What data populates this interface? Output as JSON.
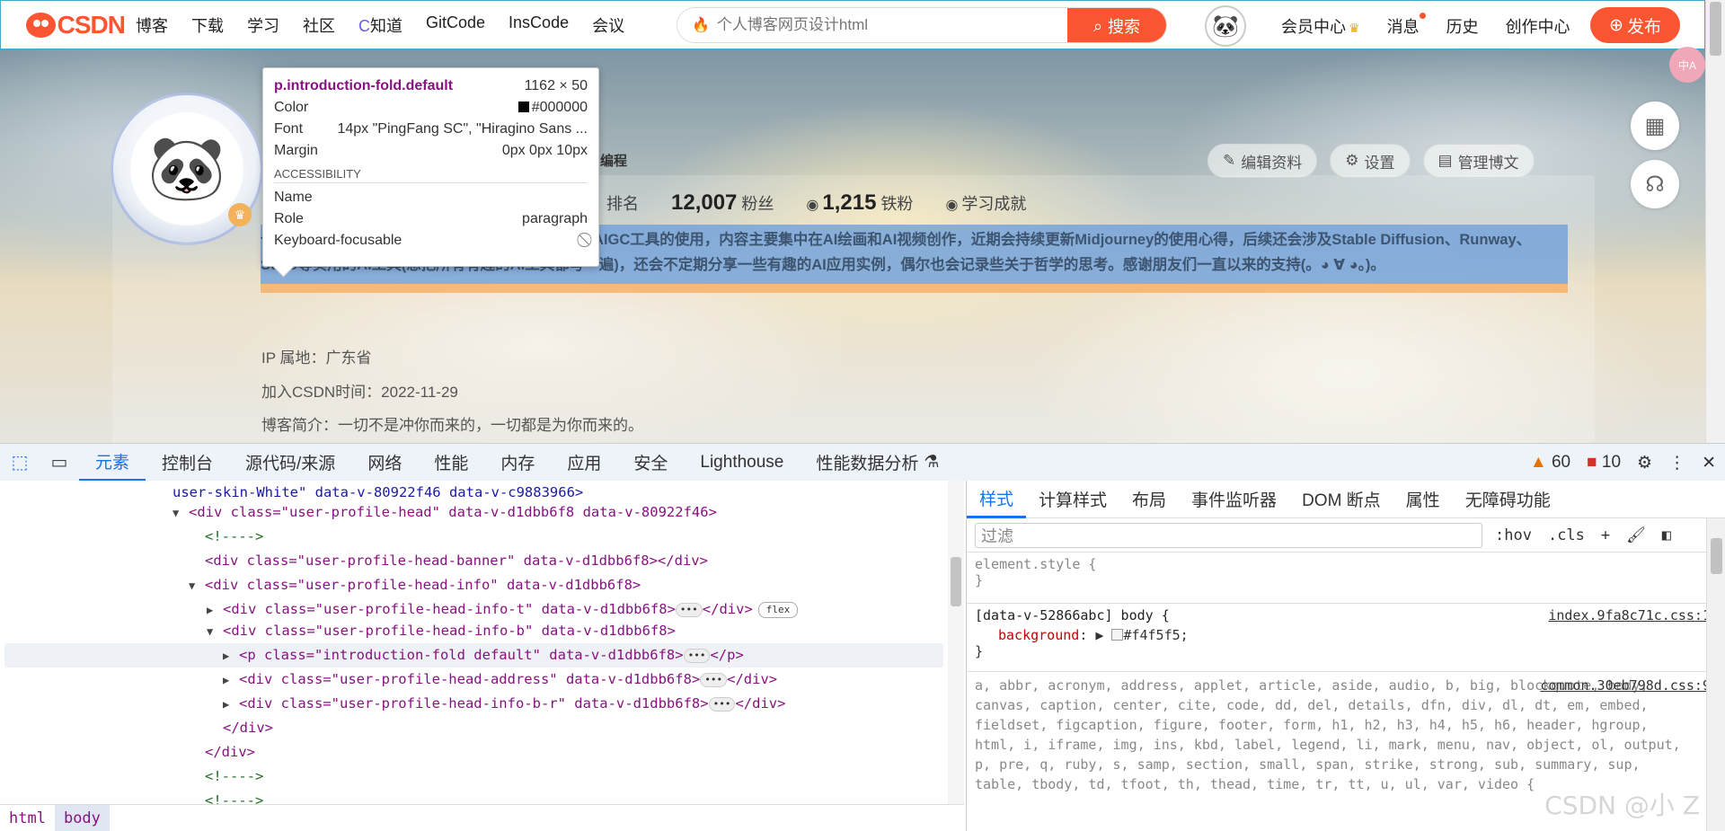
{
  "nav": {
    "brand": "CSDN",
    "links": [
      "博客",
      "下载",
      "学习",
      "社区",
      "知道",
      "GitCode",
      "InsCode",
      "会议"
    ],
    "search_placeholder": "个人博客网页设计html",
    "search_btn": "搜索",
    "right": [
      "会员中心",
      "消息",
      "历史",
      "创作中心"
    ],
    "publish": "发布"
  },
  "profile": {
    "org": "编程",
    "stats": [
      {
        "value": "",
        "label": "排名"
      },
      {
        "value": "12,007",
        "label": "粉丝"
      },
      {
        "value": "1,215",
        "label": "铁粉"
      },
      {
        "value": "",
        "label": "学习成就"
      }
    ],
    "actions": [
      "编辑资料",
      "设置",
      "管理博文"
    ],
    "intro": "个人简介：欢迎来到小ᶻZ₆的博客！现阶段主要分享AIGC工具的使用，内容主要集中在AI绘画和AI视频创作，近期会持续更新Midjourney的使用心得，后续还会涉及Stable Diffusion、Runway、Suno等实用的AI工具(想把所有有趣的AI工具都写一遍)，还会不定期分享一些有趣的AI应用实例，偶尔也会记录些关于哲学的思考。感谢朋友们一直以来的支持(。◕ ∀ ◕。)。",
    "ip": "IP 属地：广东省",
    "joined": "加入CSDN时间：2022-11-29",
    "blog_intro": "博客简介：一切不是冲你而来的，一切都是为你而来的。"
  },
  "tooltip": {
    "selector": "p.introduction-fold.default",
    "size": "1162 × 50",
    "color_label": "Color",
    "color": "#000000",
    "font_label": "Font",
    "font": "14px \"PingFang SC\", \"Hiragino Sans ...",
    "margin_label": "Margin",
    "margin": "0px 0px 10px",
    "section": "ACCESSIBILITY",
    "name_label": "Name",
    "name": "",
    "role_label": "Role",
    "role": "paragraph",
    "kf_label": "Keyboard-focusable"
  },
  "devtools": {
    "tabs": [
      "元素",
      "控制台",
      "源代码/来源",
      "网络",
      "性能",
      "内存",
      "应用",
      "安全",
      "Lighthouse",
      "性能数据分析"
    ],
    "warnings": "60",
    "errors": "10",
    "dom": [
      "user-skin-White\" data-v-80922f46 data-v-c9883966>",
      "<div class=\"user-profile-head\" data-v-d1dbb6f8 data-v-80922f46>",
      "<!---->",
      "<div class=\"user-profile-head-banner\" data-v-d1dbb6f8></div>",
      "<div class=\"user-profile-head-info\" data-v-d1dbb6f8>",
      "<div class=\"user-profile-head-info-t\" data-v-d1dbb6f8>",
      "<div class=\"user-profile-head-info-b\" data-v-d1dbb6f8>",
      "<p class=\"introduction-fold default\" data-v-d1dbb6f8>",
      "<div class=\"user-profile-head-address\" data-v-d1dbb6f8>",
      "<div class=\"user-profile-head-info-b-r\" data-v-d1dbb6f8>",
      "</div>",
      "</div>",
      "<!---->",
      "<!---->"
    ],
    "breadcrumb": [
      "html",
      "body"
    ],
    "style_tabs": [
      "样式",
      "计算样式",
      "布局",
      "事件监听器",
      "DOM 断点",
      "属性",
      "无障碍功能"
    ],
    "filter": "过滤",
    "hov": ":hov",
    "cls": ".cls",
    "rules": {
      "el": "element.style {",
      "close": "}",
      "r2_sel": "[data-v-52866abc] body {",
      "r2_src": "index.9fa8c71c.css:1",
      "r2_prop": "background",
      "r2_val": "#f4f5f5;",
      "r3_src": "common.30eb798d.css:9",
      "r3_text": "a, abbr, acronym, address, applet, article, aside, audio, b, big, blockquote, body, canvas, caption, center, cite, code, dd, del, details, dfn, div, dl, dt, em, embed, fieldset, figcaption, figure, footer, form, h1, h2, h3, h4, h5, h6, header, hgroup, html, i, iframe, img, ins, kbd, label, legend, li, mark, menu, nav, object, ol, output, p, pre, q, ruby, s, samp, section, small, span, strike, strong, sub, summary, sup, table, tbody, td, tfoot, th, thead, time, tr, tt, u, ul, var, video {"
    },
    "watermark": "CSDN @小 Z"
  }
}
